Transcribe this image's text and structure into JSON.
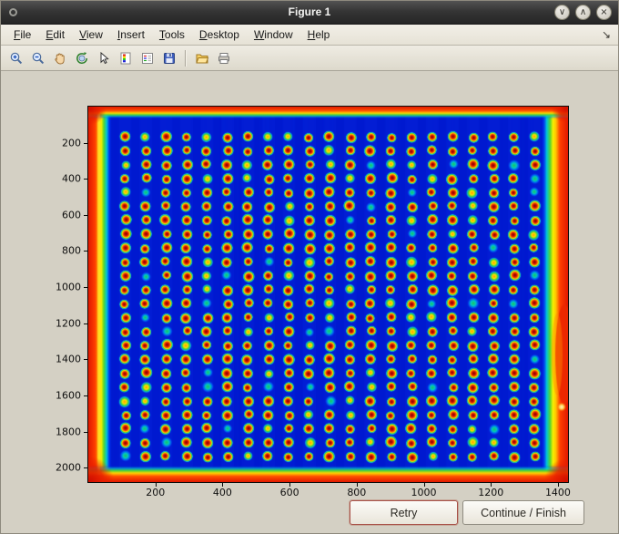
{
  "window": {
    "title": "Figure 1",
    "controls": {
      "minimize": "∨",
      "maximize": "∧",
      "close": "×"
    }
  },
  "menubar": {
    "items": [
      {
        "label": "File"
      },
      {
        "label": "Edit"
      },
      {
        "label": "View"
      },
      {
        "label": "Insert"
      },
      {
        "label": "Tools"
      },
      {
        "label": "Desktop"
      },
      {
        "label": "Window"
      },
      {
        "label": "Help"
      }
    ],
    "dock_glyph": "↘"
  },
  "toolbar": {
    "icons": [
      "zoom-in",
      "zoom-out",
      "pan",
      "rotate-3d",
      "data-cursor",
      "colorbar",
      "insert-legend",
      "save",
      "open",
      "print"
    ]
  },
  "buttons": {
    "retry": "Retry",
    "continue_finish": "Continue / Finish"
  },
  "chart_data": {
    "type": "heatmap",
    "title": "",
    "xlabel": "",
    "ylabel": "",
    "xlim": [
      0,
      1430
    ],
    "ylim": [
      0,
      2080
    ],
    "x_ticks": [
      200,
      400,
      600,
      800,
      1000,
      1200,
      1400
    ],
    "y_ticks": [
      200,
      400,
      600,
      800,
      1000,
      1200,
      1400,
      1600,
      1800,
      2000
    ],
    "colormap": "jet",
    "legend": "off",
    "grid": "off",
    "image": {
      "description": "Microarray slide scan shown with jet colormap: deep blue field, regular 21 x 24 grid of spots with dark-red cores and orange/yellow/green/cyan halos, saturated red bands along all four image edges with yellow-green transition fringes and red corner blobs",
      "field_color": "#0019d0",
      "spot_grid": {
        "cols": 21,
        "rows": 24,
        "x_start": 110,
        "x_spacing": 61,
        "y_start": 168,
        "y_spacing": 77
      },
      "spot_core_color": "#7d0000",
      "edge_color": "#e01800"
    }
  }
}
